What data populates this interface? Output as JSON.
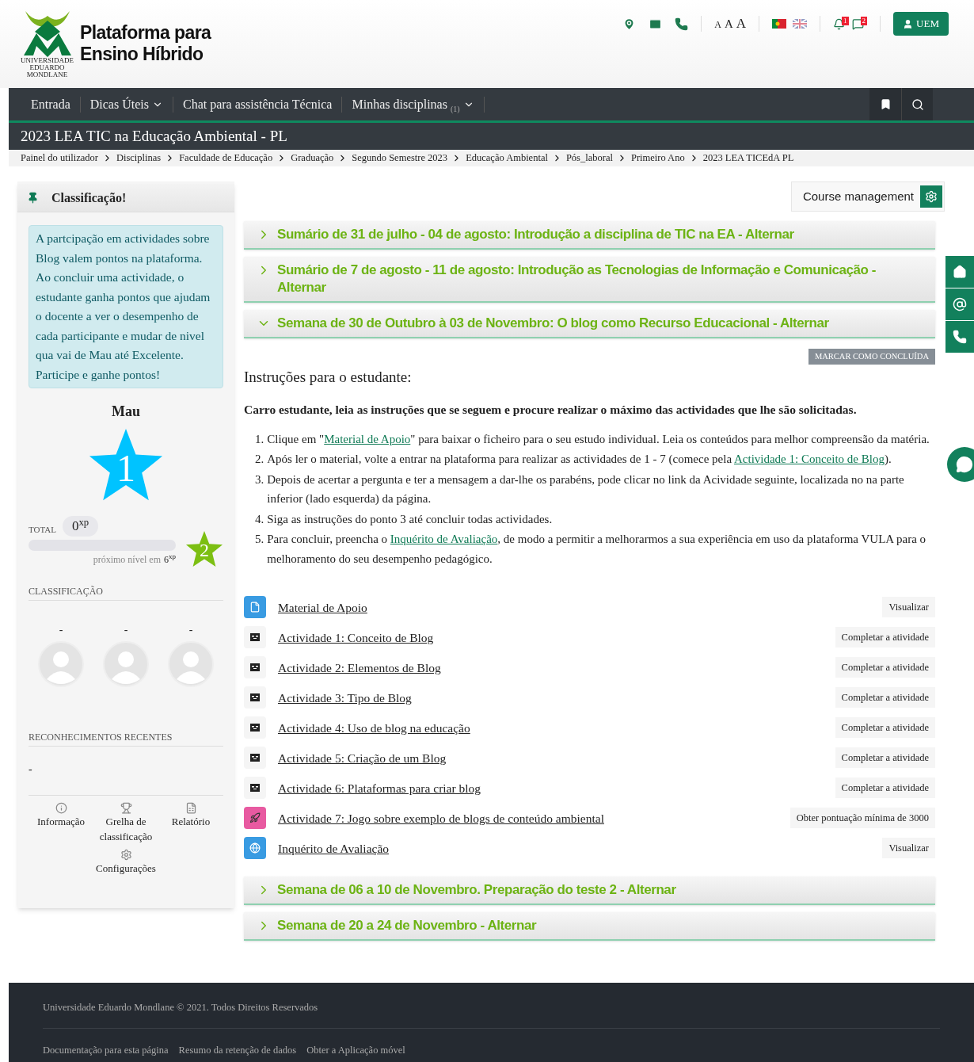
{
  "header": {
    "logo_caption": [
      "UNIVERSIDADE",
      "EDUARDO",
      "MONDLANE"
    ],
    "site_title": [
      "Plataforma para",
      "Ensino Híbrido"
    ],
    "font_sizes": [
      "A",
      "A",
      "A"
    ],
    "notification_count": "1",
    "message_count": "2",
    "user_button": "UEM"
  },
  "nav": [
    {
      "label": "Entrada",
      "dropdown": false
    },
    {
      "label": "Dicas Úteis",
      "dropdown": true
    },
    {
      "label": "Chat para assistência Técnica",
      "dropdown": false
    },
    {
      "label": "Minhas disciplinas",
      "count": "(1)",
      "dropdown": true
    }
  ],
  "course_title": "2023 LEA TIC na Educação Ambiental - PL",
  "breadcrumbs": [
    "Painel do utilizador",
    "Disciplinas",
    "Faculdade de Educação",
    "Graduação",
    "Segundo Semestre 2023",
    "Educação Ambiental",
    "Pós_laboral",
    "Primeiro Ano",
    "2023 LEA TICEdA PL"
  ],
  "sidebar": {
    "title": "Classificação!",
    "info_text": "A partcipação em actividades sobre Blog valem pontos na plataforma. Ao concluir uma actividade, o estudante ganha pontos que ajudam o docente a ver o desempenho de cada participante e mudar de nivel qua vai de Mau até Excelente. Participe e ganhe pontos!",
    "level_name": "Mau",
    "level_number": "1",
    "total_label": "TOTAL",
    "total_value": "0$^{xp}$",
    "progress": {
      "level": 0
    },
    "next_level_text": "próximo nível em",
    "next_level_value": "6$^{xp}$",
    "next_level_number": "2",
    "classification_heading": "CLASSIFICAÇÃO",
    "ranking": [
      {
        "name": "-"
      },
      {
        "name": "-"
      },
      {
        "name": "-"
      }
    ],
    "recent_heading": "RECONHECIMENTOS RECENTES",
    "recent_text": "-",
    "links": [
      {
        "kind": "info",
        "label": "Informação"
      },
      {
        "kind": "trophy",
        "label": "Grelha de classificação"
      },
      {
        "kind": "report",
        "label": "Relatório"
      },
      {
        "kind": "settings",
        "label": "Configurações"
      }
    ]
  },
  "course_management": "Course management",
  "sections": [
    {
      "title": "Sumário de 31 de julho - 04 de agosto: Introdução a disciplina de TIC na EA - Alternar",
      "expanded": false
    },
    {
      "title": "Sumário de 7 de agosto - 11 de agosto: Introdução as Tecnologias de Informação e Comunicação - Alternar",
      "expanded": false
    },
    {
      "title": "Semana de 30 de Outubro à 03 de Novembro: O blog como Recurso Educacional - Alternar",
      "expanded": true,
      "mark_button": "MARCAR COMO CONCLUÍDA",
      "heading": "Instruções para o estudante:",
      "intro": "Carro estudante, leia as instruções que se seguem e procure realizar o máximo das actividades que lhe são solicitadas.",
      "steps": [
        {
          "number": "1.",
          "text": "Clique em \"",
          "link": "Material de Apoio",
          "after": "\" para baixar o ficheiro para o seu estudo individual. Leia os conteúdos para melhor compreensão da matéria."
        },
        {
          "number": "2.",
          "text": "Após ler o material, volte a entrar na plataforma para realizar as actividades de 1 - 7 (comece pela ",
          "link": "Actividade 1: Conceito de Blog",
          "after": ")."
        },
        {
          "number": "3.",
          "text": "Depois de acertar a pergunta e ter a mensagem a dar-lhe os parabéns, pode clicar no link da Acividade seguinte, localizada no na parte inferior (lado esquerda) da página."
        },
        {
          "number": "4.",
          "text": "Siga as instruções do ponto 3 até concluir todas actividades."
        },
        {
          "number": "5.",
          "text": "Para concluir, preencha o ",
          "link": "Inquérito de Avaliação",
          "after": ", de modo a permitir a melhorarmos a sua experiência em uso da plataforma VULA para o melhoramento do seu desempenho pedagógico."
        }
      ],
      "activities": [
        {
          "kind": "file",
          "title": "Material de Apoio",
          "action": "Visualizar"
        },
        {
          "kind": "hvp",
          "title": "Actividade 1: Conceito de Blog",
          "action": "Completar a atividade"
        },
        {
          "kind": "hvp",
          "title": "Actividade 2: Elementos de Blog",
          "action": "Completar a atividade"
        },
        {
          "kind": "hvp",
          "title": "Actividade 3: Tipo de Blog",
          "action": "Completar a atividade"
        },
        {
          "kind": "hvp",
          "title": "Actividade 4: Uso de blog na educação",
          "action": "Completar a atividade"
        },
        {
          "kind": "hvp",
          "title": "Actividade 5: Criação de um Blog",
          "action": "Completar a atividade"
        },
        {
          "kind": "hvp",
          "title": "Actividade 6: Plataformas para criar blog",
          "action": "Completar a atividade"
        },
        {
          "kind": "game",
          "title": "Actividade 7: Jogo sobre exemplo de blogs de conteúdo ambiental",
          "action": "Obter pontuação mínima de 3000"
        },
        {
          "kind": "survey",
          "title": "Inquérito de Avaliação",
          "action": "Visualizar"
        }
      ]
    },
    {
      "title": "Semana de 06 a 10 de Novembro. Preparação do teste 2 - Alternar",
      "expanded": false
    },
    {
      "title": "Semana de 20 a 24 de Novembro - Alternar",
      "expanded": false
    }
  ],
  "footer": {
    "copyright": "Universidade Eduardo Mondlane © 2021. Todos Direitos Reservados",
    "links": [
      "Documentação para esta página",
      "Resumo da retenção de dados",
      "Obter a Aplicação móvel"
    ]
  }
}
